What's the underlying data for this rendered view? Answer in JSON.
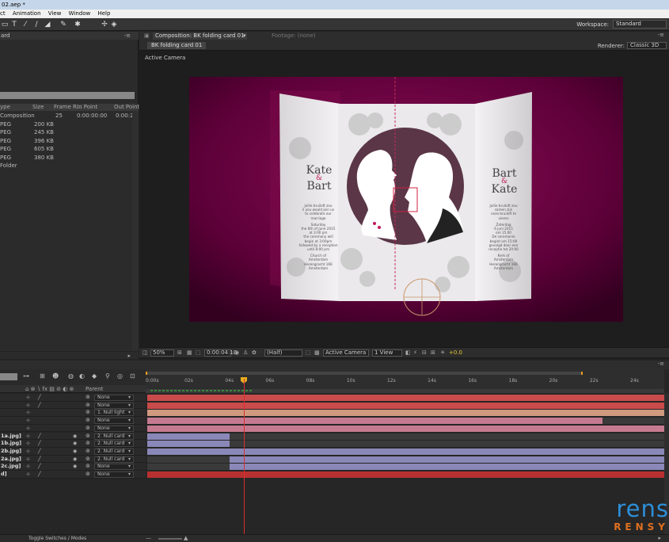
{
  "window": {
    "title": "02.aep *"
  },
  "menu": [
    "ct",
    "Animation",
    "View",
    "Window",
    "Help"
  ],
  "workspace": {
    "label": "Workspace:",
    "value": "Standard"
  },
  "project": {
    "tab_label": "ard",
    "columns": [
      "ype",
      "Size",
      "Frame R...",
      "In Point",
      "Out Point"
    ],
    "rows": [
      {
        "type": "Composition",
        "size": "",
        "fps": "25",
        "in": "0:00:00:00",
        "out": "0:00:3"
      },
      {
        "type": "PEG",
        "size": "200 KB",
        "fps": "",
        "in": "",
        "out": ""
      },
      {
        "type": "PEG",
        "size": "245 KB",
        "fps": "",
        "in": "",
        "out": ""
      },
      {
        "type": "PEG",
        "size": "396 KB",
        "fps": "",
        "in": "",
        "out": ""
      },
      {
        "type": "PEG",
        "size": "605 KB",
        "fps": "",
        "in": "",
        "out": ""
      },
      {
        "type": "PEG",
        "size": "380 KB",
        "fps": "",
        "in": "",
        "out": ""
      },
      {
        "type": "Folder",
        "size": "",
        "fps": "",
        "in": "",
        "out": ""
      }
    ]
  },
  "composition": {
    "tab_label": "Composition: BK folding card 01",
    "footage_label": "Footage: (none)",
    "sub_tab": "BK folding card 01",
    "renderer_label": "Renderer:",
    "renderer_value": "Classic 3D",
    "active_camera": "Active Camera",
    "footer": {
      "zoom": "50%",
      "timecode": "0:00:04:10",
      "resolution": "(Half)",
      "view": "Active Camera",
      "views": "1 View",
      "exposure": "+0.0"
    },
    "card": {
      "left_title_1": "Kate",
      "left_amp": "&",
      "left_title_2": "Bart",
      "right_title_1": "Bart",
      "right_amp": "&",
      "right_title_2": "Kate",
      "left_text": [
        "Jullie bruiloft zou",
        "il you would join us",
        "to celebrate our",
        "marriage",
        "Saturday",
        "the 6th of June 2015",
        "at 3:00 pm",
        "the ceremony will",
        "begin at 3:00pm",
        "followed by a reception",
        "until 8:00 pm",
        "Church of",
        "Amsterdam",
        "Herengracht 166",
        "Amsterdam"
      ],
      "right_text": [
        "Jullie bruiloft zou",
        "samen zijn",
        "onze bruiloft te",
        "vieren",
        "Zaterdag",
        "6 juni 2015",
        "om 15.00",
        "De ceremonie",
        "begint om 15:00",
        "gevolgd door een",
        "receptie tot 20:00",
        "Kerk of",
        "Amsterdam",
        "Herengracht 166",
        "Amsterdam"
      ]
    }
  },
  "timeline": {
    "columns_label": "Parent",
    "ticks": [
      "0:00s",
      "02s",
      "04s",
      "06s",
      "08s",
      "10s",
      "12s",
      "14s",
      "16s",
      "18s",
      "20s",
      "22s",
      "24s"
    ],
    "layers": [
      {
        "name": "",
        "parent": "None",
        "color": "#c94b4b",
        "bar_start": 0,
        "bar_end": 1
      },
      {
        "name": "",
        "parent": "None",
        "color": "#c94b4b",
        "bar_start": 0,
        "bar_end": 1
      },
      {
        "name": "",
        "parent": "1. Null light",
        "color": "#d09a7e",
        "bar_start": 0,
        "bar_end": 1
      },
      {
        "name": "",
        "parent": "None",
        "color": "#c67a90",
        "bar_start": 0,
        "bar_end": 0.88
      },
      {
        "name": "",
        "parent": "None",
        "color": "#c67a90",
        "bar_start": 0,
        "bar_end": 1
      },
      {
        "name": "1a.jpg]",
        "parent": "2. Null card",
        "color": "#8a88b8",
        "bar_start": 0,
        "bar_end": 0.16
      },
      {
        "name": "1b.jpg]",
        "parent": "2. Null card",
        "color": "#8a88b8",
        "bar_start": 0,
        "bar_end": 0.16
      },
      {
        "name": "2b.jpg]",
        "parent": "2. Null card",
        "color": "#8a88b8",
        "bar_start": 0,
        "bar_end": 1
      },
      {
        "name": "2a.jpg]",
        "parent": "2. Null card",
        "color": "#8a88b8",
        "bar_start": 0.16,
        "bar_end": 1
      },
      {
        "name": "2c.jpg]",
        "parent": "None",
        "color": "#8a88b8",
        "bar_start": 0.16,
        "bar_end": 1
      },
      {
        "name": "d]",
        "parent": "None",
        "color": "#b83030",
        "bar_start": 0,
        "bar_end": 1
      }
    ],
    "toggle_label": "Toggle Switches / Modes"
  },
  "watermark": {
    "top": "rens",
    "bottom": "RENSY"
  },
  "colors": {
    "card_bg": "#e8e6e8",
    "backdrop": "#4d0030",
    "circle": "#5a3647",
    "accent": "#c2185b"
  }
}
